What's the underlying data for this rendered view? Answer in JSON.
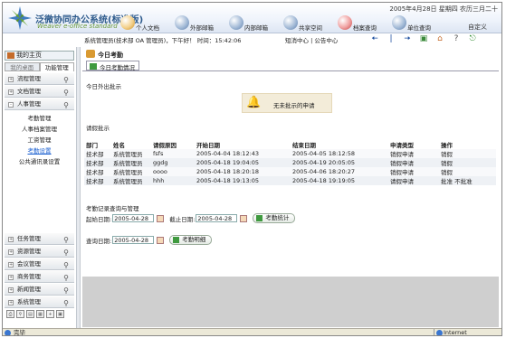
{
  "header": {
    "title_cn": "泛微协同办公系统(标准版)",
    "title_en": "Weaver e-office standard",
    "datetime": "2005年4月28日 星期四 农历三月二十",
    "custom": "自定义",
    "nav": [
      "个人文档",
      "外部邮箱",
      "内部邮箱",
      "共享空间",
      "档案查询",
      "单位查询"
    ]
  },
  "userbar": {
    "info": "系统管理员(技术部 OA 管理员)，下午好！ 时间：15:42:06",
    "msg_center": "短消中心 | 公告中心"
  },
  "sidebar": {
    "home": "我的主页",
    "tabs": [
      "我的桌面",
      "功能管理"
    ],
    "top_items": [
      "流程管理",
      "文档管理",
      "人事管理"
    ],
    "sub_items": [
      "考勤管理",
      "人事档案管理",
      "工资管理",
      "考勤设置",
      "公共通讯录设置"
    ],
    "bottom_items": [
      "任务管理",
      "资源管理",
      "会议管理",
      "商务管理",
      "新闻管理",
      "系统管理"
    ]
  },
  "main": {
    "title": "今日考勤",
    "subtab": "今日考勤情况",
    "today_out": "今日外出批示",
    "notice": "无未批示的申请",
    "leave_section": "请假批示",
    "table": {
      "headers": [
        "部门",
        "姓名",
        "请假原因",
        "开始日期",
        "结束日期",
        "申请类型",
        "操作"
      ],
      "rows": [
        [
          "技术部",
          "系统管理员",
          "fsfs",
          "2005-04-04 18:12:43",
          "2005-04-05 18:12:58",
          "销假申请",
          "销假"
        ],
        [
          "技术部",
          "系统管理员",
          "ggdg",
          "2005-04-18 19:04:05",
          "2005-04-19 20:05:05",
          "销假申请",
          "销假"
        ],
        [
          "技术部",
          "系统管理员",
          "oooo",
          "2005-04-18 18:20:18",
          "2005-04-06 18:20:27",
          "销假申请",
          "销假"
        ],
        [
          "技术部",
          "系统管理员",
          "hhh",
          "2005-04-18 19:13:05",
          "2005-04-18 19:19:05",
          "请假申请",
          "批准 不批准"
        ]
      ]
    },
    "query_section": "考勤记录查询与管理",
    "start_label": "起始日期:",
    "start_value": "2005-04-28",
    "end_label": "截止日期:",
    "end_value": "2005-04-28",
    "stats_button": "考勤统计",
    "query_label": "查询日期:",
    "query_value": "2005-04-28",
    "detail_button": "考勤明细"
  },
  "statusbar": {
    "done": "完毕",
    "zone": "Internet"
  }
}
